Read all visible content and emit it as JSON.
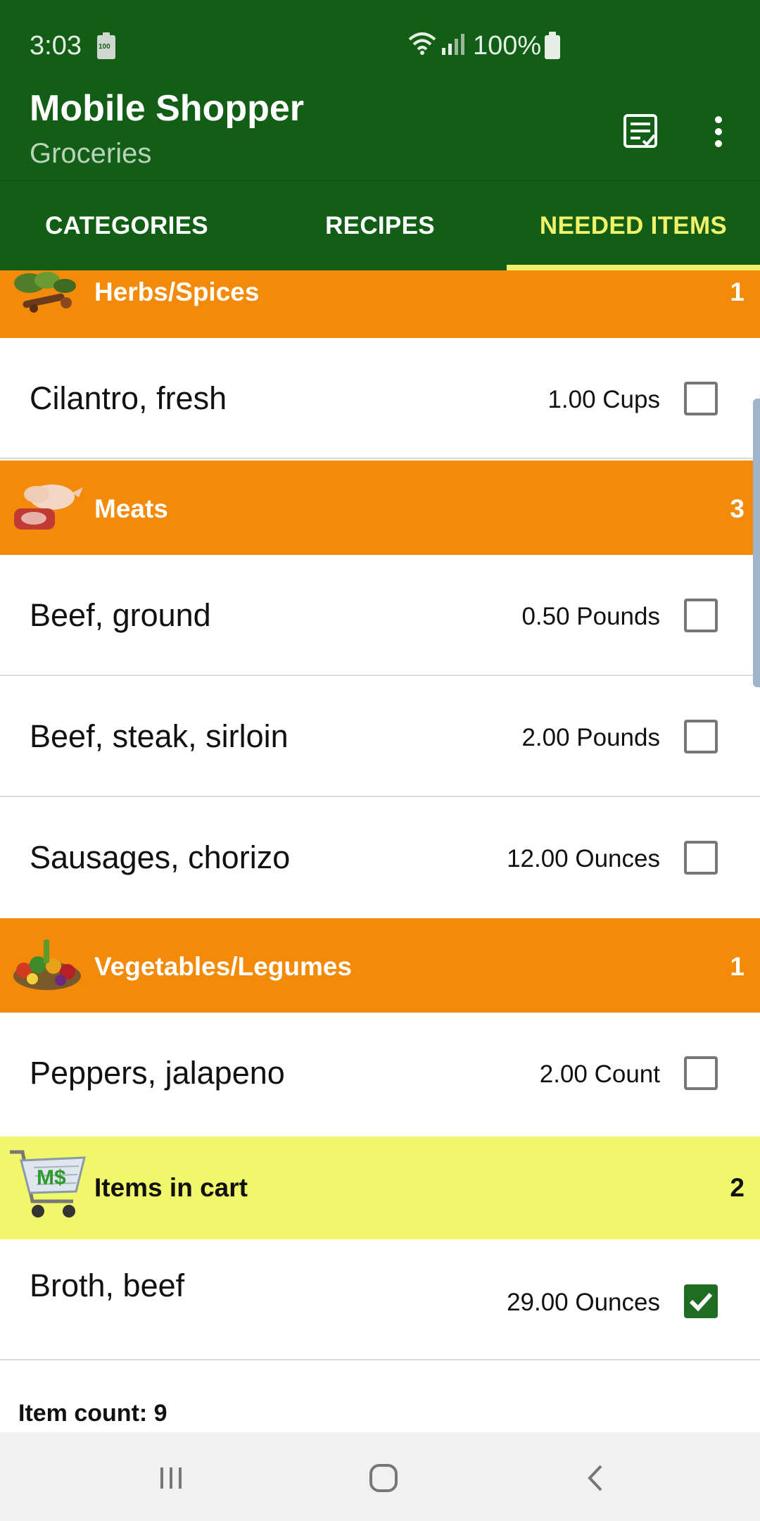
{
  "status_bar": {
    "time": "3:03",
    "battery_small_label": "100",
    "battery_percent": "100%"
  },
  "app": {
    "title": "Mobile Shopper",
    "subtitle": "Groceries",
    "toolbar_icons": [
      "list-check-icon",
      "more-vert-icon"
    ]
  },
  "tabs": [
    {
      "label": "CATEGORIES",
      "active": false
    },
    {
      "label": "RECIPES",
      "active": false
    },
    {
      "label": "NEEDED ITEMS",
      "active": true
    }
  ],
  "sections": [
    {
      "name": "Herbs/Spices",
      "count": "1",
      "icon": "herbs-spices-image",
      "items": [
        {
          "name": "Cilantro, fresh",
          "qty": "1.00 Cups",
          "checked": false
        }
      ]
    },
    {
      "name": "Meats",
      "count": "3",
      "icon": "meats-image",
      "items": [
        {
          "name": "Beef, ground",
          "qty": "0.50 Pounds",
          "checked": false
        },
        {
          "name": "Beef, steak, sirloin",
          "qty": "2.00 Pounds",
          "checked": false
        },
        {
          "name": "Sausages, chorizo",
          "qty": "12.00 Ounces",
          "checked": false
        }
      ]
    },
    {
      "name": "Vegetables/Legumes",
      "count": "1",
      "icon": "vegetables-image",
      "items": [
        {
          "name": "Peppers, jalapeno",
          "qty": "2.00 Count",
          "checked": false
        }
      ]
    }
  ],
  "cart": {
    "name": "Items in cart",
    "count": "2",
    "icon": "shopping-cart-icon",
    "logo_text": "M$",
    "items": [
      {
        "name": "Broth, beef",
        "qty": "29.00 Ounces",
        "checked": true
      }
    ]
  },
  "footer": {
    "item_count": "Item count: 9"
  },
  "colors": {
    "app_bar": "#135e16",
    "tab_indicator": "#f2f26a",
    "category_header": "#f38a0a",
    "cart_header": "#f0f76a",
    "checkbox_checked": "#1f6d23"
  },
  "nav_buttons": [
    "recent-apps-icon",
    "home-icon",
    "back-icon"
  ]
}
